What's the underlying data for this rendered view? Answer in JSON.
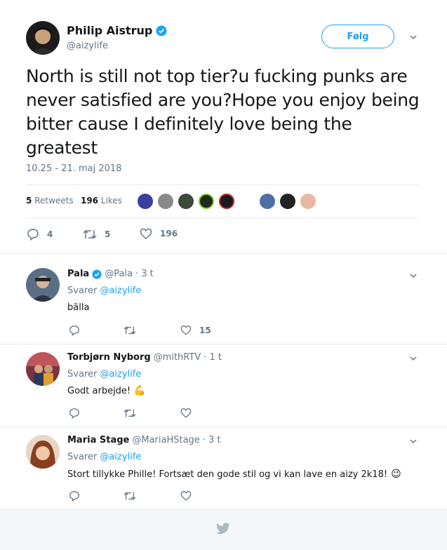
{
  "tweet": {
    "author_name": "Philip Aistrup",
    "author_handle": "@aizylife",
    "follow_label": "Følg",
    "text": "North is still not top tier?u fucking punks are never satisfied are you?Hope you enjoy being bitter cause I definitely love being the greatest",
    "timestamp": "10.25 - 21. maj 2018",
    "retweet_count": "5",
    "retweet_label": "Retweets",
    "like_count": "196",
    "like_label": "Likes",
    "reply_action_count": "4",
    "retweet_action_count": "5",
    "like_action_count": "196"
  },
  "replies": [
    {
      "name": "Pala",
      "handle": "@Pala",
      "time": "· 3 t",
      "replying_to_prefix": "Svarer",
      "replying_to": "@aizylife",
      "text": "bälla",
      "like_count": "15"
    },
    {
      "name": "Torbjørn Nyborg",
      "handle": "@mithRTV",
      "time": "· 1 t",
      "replying_to_prefix": "Svarer",
      "replying_to": "@aizylife",
      "text": "Godt arbejde!",
      "emoji": "💪"
    },
    {
      "name": "Maria Stage",
      "handle": "@MariaHStage",
      "time": "· 3 t",
      "replying_to_prefix": "Svarer",
      "replying_to": "@aizylife",
      "text": "Stort tillykke Phille! Fortsæt den gode stil og vi kan lave en aizy 2k18!",
      "emoji": "😉"
    }
  ],
  "colors": {
    "accent": "#1da1f2",
    "muted": "#657786",
    "divider": "#e6ecf0",
    "footer_bg": "#f5f8fa"
  }
}
